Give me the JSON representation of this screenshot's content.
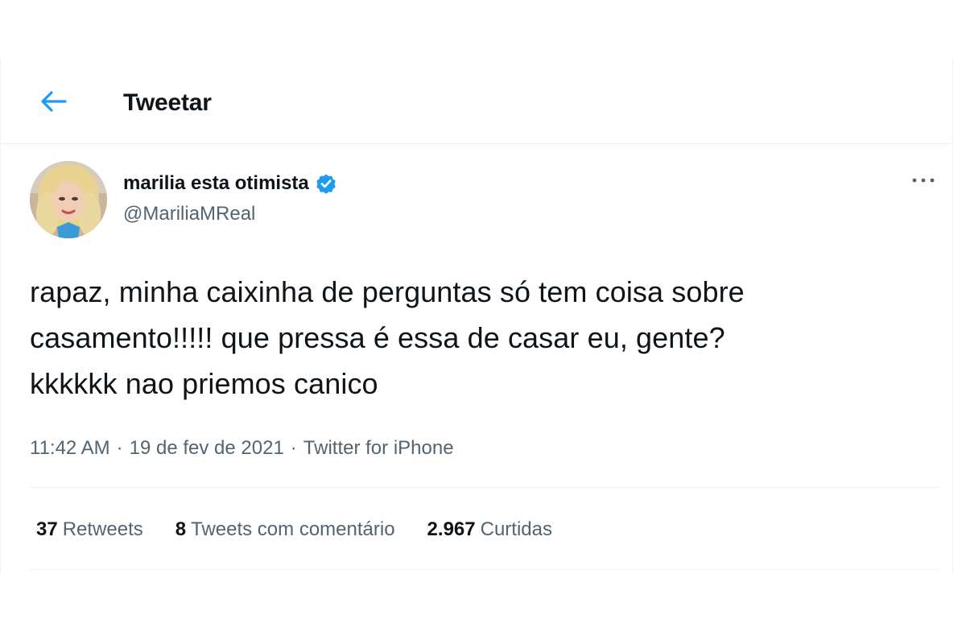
{
  "header": {
    "title": "Tweetar",
    "back_icon": "arrow-left-icon"
  },
  "tweet": {
    "author": {
      "display_name": "marilia esta otimista",
      "handle": "@MariliaMReal",
      "verified_icon": "verified-badge-icon",
      "avatar": "profile-photo"
    },
    "more_icon": "more-horizontal-icon",
    "text_lines": [
      "rapaz, minha caixinha de perguntas só tem coisa sobre",
      "casamento!!!!! que pressa é essa de casar eu, gente?",
      "kkkkkk nao priemos canico"
    ],
    "time": "11:42 AM",
    "date": "19 de fev de 2021",
    "separator": "·",
    "source": "Twitter for iPhone"
  },
  "stats": {
    "retweets": {
      "count": "37",
      "label": "Retweets"
    },
    "quotes": {
      "count": "8",
      "label": "Tweets com comentário"
    },
    "likes": {
      "count": "2.967",
      "label": "Curtidas"
    }
  },
  "colors": {
    "accent": "#1d9bf0",
    "text_primary": "#0f1419",
    "text_secondary": "#536471",
    "divider": "#eff3f4"
  }
}
